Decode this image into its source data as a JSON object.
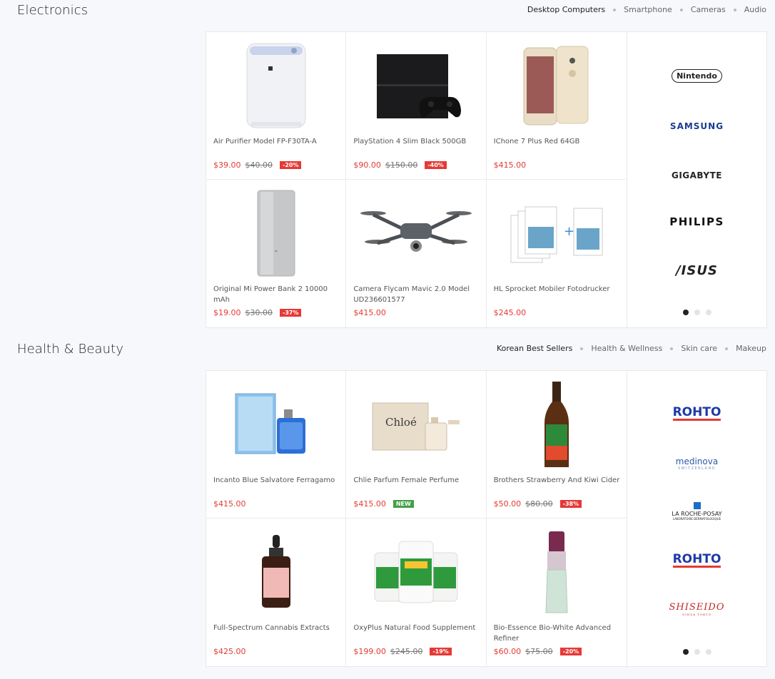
{
  "sections": [
    {
      "title": "Electronics",
      "tabs": [
        "Desktop Computers",
        "Smartphone",
        "Cameras",
        "Audio"
      ],
      "products": [
        {
          "name": "Air Purifier Model FP-F30TA-A",
          "price": "$39.00",
          "old_price": "$40.00",
          "badge": "-20%",
          "image": "air-purifier-image"
        },
        {
          "name": "PlayStation 4 Slim Black 500GB",
          "price": "$90.00",
          "old_price": "$150.00",
          "badge": "-40%",
          "image": "game-console-image"
        },
        {
          "name": "IChone 7 Plus Red 64GB",
          "price": "$415.00",
          "old_price": "",
          "badge": "",
          "image": "smartphone-image"
        },
        {
          "name": "Original Mi Power Bank 2 10000 mAh",
          "price": "$19.00",
          "old_price": "$30.00",
          "badge": "-37%",
          "image": "power-bank-image"
        },
        {
          "name": "Camera Flycam Mavic 2.0 Model UD236601577",
          "price": "$415.00",
          "old_price": "",
          "badge": "",
          "image": "drone-image"
        },
        {
          "name": "HL Sprocket Mobiler Fotodrucker",
          "price": "$245.00",
          "old_price": "",
          "badge": "",
          "image": "photo-paper-image"
        }
      ],
      "brands": [
        "Nintendo",
        "SAMSUNG",
        "GIGABYTE",
        "PHILIPS",
        "/ISUS"
      ]
    },
    {
      "title": "Health & Beauty",
      "tabs": [
        "Korean Best Sellers",
        "Health & Wellness",
        "Skin care",
        "Makeup"
      ],
      "products": [
        {
          "name": "Incanto Blue Salvatore Ferragamo",
          "price": "$415.00",
          "old_price": "",
          "badge": "",
          "image": "perfume-blue-image"
        },
        {
          "name": "Chlie Parfum Female Perfume",
          "price": "$415.00",
          "old_price": "",
          "badge": "NEW",
          "image": "perfume-chloe-image"
        },
        {
          "name": "Brothers Strawberry And Kiwi Cider",
          "price": "$50.00",
          "old_price": "$80.00",
          "badge": "-38%",
          "image": "cider-bottle-image"
        },
        {
          "name": "Full-Spectrum Cannabis Extracts",
          "price": "$425.00",
          "old_price": "",
          "badge": "",
          "image": "dropper-bottle-image"
        },
        {
          "name": "OxyPlus Natural Food Supplement",
          "price": "$199.00",
          "old_price": "$245.00",
          "badge": "-19%",
          "image": "supplement-jars-image"
        },
        {
          "name": "Bio-Essence Bio-White Advanced Refiner",
          "price": "$60.00",
          "old_price": "$75.00",
          "badge": "-20%",
          "image": "serum-bottle-image"
        }
      ],
      "brands": [
        "ROHTO",
        "medinova",
        "LA ROCHE-POSAY",
        "ROHTO",
        "SHISEIDO"
      ],
      "brand_sub": {
        "medinova": "SWITZERLAND",
        "laroche": "LABORATOIRE DERMATOLOGIQUE",
        "shiseido": "GINZA TOKYO"
      }
    }
  ],
  "colors": {
    "price": "#e53935",
    "badge_sale": "#e53935",
    "badge_new": "#43a047"
  }
}
